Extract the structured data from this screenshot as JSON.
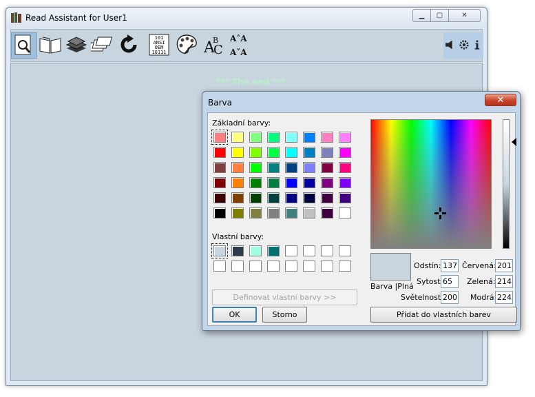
{
  "window": {
    "title": "Read Assistant for User1",
    "minimize_glyph": "▁",
    "maximize_glyph": "▢",
    "close_glyph": "✕"
  },
  "toolbar": {
    "items": [
      {
        "name": "find-icon"
      },
      {
        "name": "open-book-icon"
      },
      {
        "name": "books-icon"
      },
      {
        "name": "pages-icon"
      },
      {
        "name": "refresh-icon"
      },
      {
        "name": "binary-text-icon",
        "text_lines": [
          "101",
          "ANSI",
          "OEM",
          "10111"
        ]
      },
      {
        "name": "palette-icon"
      },
      {
        "name": "font-icon"
      }
    ],
    "font_size": {
      "increase": "A˄A",
      "decrease": "A˅A"
    },
    "right_items": [
      {
        "name": "speaker-icon"
      },
      {
        "name": "settings-icon"
      },
      {
        "name": "info-icon"
      }
    ]
  },
  "document": {
    "end_text": "*** The end ***"
  },
  "dialog": {
    "title": "Barva",
    "close_glyph": "✕",
    "basic_colors_label": "Základní barvy:",
    "basic_colors": [
      [
        "#ff8080",
        "#ffff80",
        "#80ff80",
        "#00ff80",
        "#80ffff",
        "#0080ff",
        "#ff80c0",
        "#ff80ff"
      ],
      [
        "#ff0000",
        "#ffff00",
        "#80ff00",
        "#00ff40",
        "#00ffff",
        "#0080c0",
        "#8080c0",
        "#ff00ff"
      ],
      [
        "#804040",
        "#ff8040",
        "#00ff00",
        "#008080",
        "#004080",
        "#8080ff",
        "#800040",
        "#ff0080"
      ],
      [
        "#800000",
        "#ff8000",
        "#008000",
        "#008040",
        "#0000ff",
        "#0000a0",
        "#800080",
        "#8000ff"
      ],
      [
        "#400000",
        "#804000",
        "#004000",
        "#004040",
        "#000080",
        "#000040",
        "#400040",
        "#400080"
      ],
      [
        "#000000",
        "#808000",
        "#808040",
        "#808080",
        "#408080",
        "#c0c0c0",
        "#400040",
        "#ffffff"
      ]
    ],
    "custom_colors_label": "Vlastní barvy:",
    "custom_colors": [
      [
        "#c9d6e0",
        "#2f3b4a",
        "#a0ffe0",
        "#007070",
        "#ffffff",
        "#ffffff",
        "#ffffff",
        "#ffffff"
      ],
      [
        "#ffffff",
        "#ffffff",
        "#ffffff",
        "#ffffff",
        "#ffffff",
        "#ffffff",
        "#ffffff",
        "#ffffff"
      ]
    ],
    "define_custom_button": "Definovat vlastní barvy >>",
    "ok_button": "OK",
    "cancel_button": "Storno",
    "preview_label": "Barva |Plná",
    "preview_color": "#c9d6e0",
    "hue_label": "Odstín:",
    "hue_value": "137",
    "sat_label": "Sytost:",
    "sat_value": "65",
    "lum_label": "Světelnost:",
    "lum_value": "200",
    "red_label": "Červená:",
    "red_value": "201",
    "green_label": "Zelená:",
    "green_value": "214",
    "blue_label": "Modrá:",
    "blue_value": "224",
    "add_custom_button": "Přidat do vlastních barev"
  }
}
